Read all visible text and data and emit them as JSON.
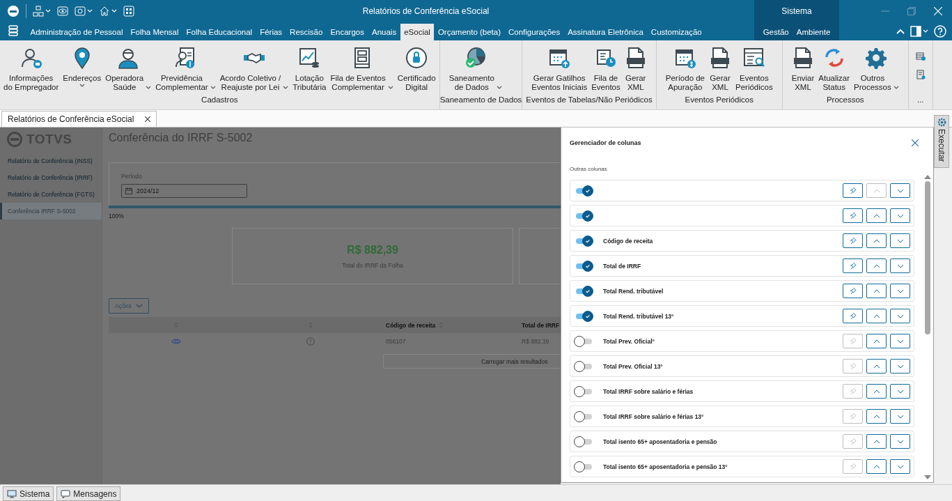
{
  "window": {
    "title": "Relatórios de Conferência eSocial",
    "section": "Sistema"
  },
  "menu": {
    "tabs": [
      {
        "label": "Administração de Pessoal",
        "selected": false
      },
      {
        "label": "Folha Mensal",
        "selected": false
      },
      {
        "label": "Folha Educacional",
        "selected": false
      },
      {
        "label": "Férias",
        "selected": false
      },
      {
        "label": "Rescisão",
        "selected": false
      },
      {
        "label": "Encargos",
        "selected": false
      },
      {
        "label": "Anuais",
        "selected": false
      },
      {
        "label": "eSocial",
        "selected": true
      },
      {
        "label": "Orçamento (beta)",
        "selected": false
      },
      {
        "label": "Configurações",
        "selected": false
      },
      {
        "label": "Assinatura Eletrônica",
        "selected": false
      },
      {
        "label": "Customização",
        "selected": false
      }
    ],
    "system_tabs": [
      {
        "label": "Gestão",
        "selected": false
      },
      {
        "label": "Ambiente",
        "selected": false
      }
    ]
  },
  "ribbon": {
    "groups": [
      {
        "caption": "Cadastros",
        "items": [
          {
            "label": "Informações\ndo Empregador",
            "has_menu": false
          },
          {
            "label": "Endereços",
            "has_menu": true
          },
          {
            "label": "Operadora\nSaúde",
            "has_menu": true
          },
          {
            "label": "Previdência\nComplementar",
            "has_menu": true
          },
          {
            "label": "Acordo Coletivo /\nReajuste por Lei",
            "has_menu": true
          },
          {
            "label": "Lotação\nTributária",
            "has_menu": false
          },
          {
            "label": "Fila de Eventos\nComplementar",
            "has_menu": true
          },
          {
            "label": "Certificado\nDigital",
            "has_menu": false
          }
        ]
      },
      {
        "caption": "Saneamento de Dados",
        "items": [
          {
            "label": "Saneamento\nde Dados",
            "has_menu": true
          }
        ]
      },
      {
        "caption": "Eventos de Tabelas/Não Periódicos",
        "items": [
          {
            "label": "Gerar Gatilhos\nEventos Iniciais",
            "has_menu": false
          },
          {
            "label": "Fila de\nEventos",
            "has_menu": false
          },
          {
            "label": "Gerar\nXML",
            "has_menu": false
          }
        ]
      },
      {
        "caption": "Eventos Periódicos",
        "items": [
          {
            "label": "Período de\nApuração",
            "has_menu": false
          },
          {
            "label": "Gerar\nXML",
            "has_menu": false
          },
          {
            "label": "Eventos\nPeriódicos",
            "has_menu": false
          }
        ]
      },
      {
        "caption": "Processos",
        "items": [
          {
            "label": "Enviar\nXML",
            "has_menu": false
          },
          {
            "label": "Atualizar\nStatus",
            "has_menu": false
          },
          {
            "label": "Outros\nProcessos",
            "has_menu": true
          }
        ]
      }
    ],
    "more_caption": "..."
  },
  "document_tabs": [
    {
      "label": "Relatórios de Conferência eSocial",
      "selected": true
    }
  ],
  "sidebar": {
    "brand": "TOTVS",
    "items": [
      {
        "label": "Relatório de Conferência (INSS)",
        "selected": false
      },
      {
        "label": "Relatório de Conferência (IRRF)",
        "selected": false
      },
      {
        "label": "Relatório de Conferência (FGTS)",
        "selected": false
      },
      {
        "label": "Conferência IRRF S-5002",
        "selected": true
      }
    ]
  },
  "page": {
    "title": "Conferência do IRRF S-5002",
    "period": {
      "label": "Período",
      "value": "2024/12"
    },
    "progress": {
      "level": 1,
      "reading": "100%"
    },
    "summary": {
      "value": "R$ 882,39",
      "caption": "Total do IRRF da Folha"
    },
    "actions_button": "Ações",
    "table": {
      "columns": [
        {
          "sortable": true
        },
        {
          "sortable": true
        },
        {
          "label": "Código de receita",
          "sortable": true
        },
        {
          "label": "Total de IRRF",
          "sortable": false
        }
      ],
      "rows": [
        {
          "cells": [
            "056107",
            "R$ 882,39"
          ]
        }
      ]
    },
    "load_more": "Carregar mais resultados"
  },
  "column_manager": {
    "title": "Gerenciador de colunas",
    "section": "Outras colunas",
    "columns": [
      {
        "visible": true,
        "move_up_disabled": true
      },
      {
        "visible": true,
        "move_up_disabled": false
      },
      {
        "label": "Código de receita",
        "visible": true,
        "move_up_disabled": false
      },
      {
        "label": "Total de IRRF",
        "visible": true,
        "move_up_disabled": false
      },
      {
        "label": "Total Rend. tributável",
        "visible": true,
        "move_up_disabled": false
      },
      {
        "label": "Total Rend. tributável 13°",
        "visible": true,
        "move_up_disabled": false
      },
      {
        "label": "Total Prev. Oficial°",
        "visible": false,
        "move_up_disabled": false
      },
      {
        "label": "Total Prev. Oficial 13°",
        "visible": false,
        "move_up_disabled": false
      },
      {
        "label": "Total IRRF sobre salário e férias",
        "visible": false,
        "move_up_disabled": false
      },
      {
        "label": "Total IRRF sobre salário e férias 13°",
        "visible": false,
        "move_up_disabled": false
      },
      {
        "label": "Total isento 65+ aposentadoria e pensão",
        "visible": false,
        "move_up_disabled": false
      },
      {
        "label": "Total isento 65+ aposentadoria e pensão 13°",
        "visible": false,
        "move_up_disabled": false
      }
    ]
  },
  "side_panel": {
    "tab": "Executar"
  },
  "status_bar": {
    "buttons": [
      "Sistema",
      "Mensagens"
    ]
  }
}
